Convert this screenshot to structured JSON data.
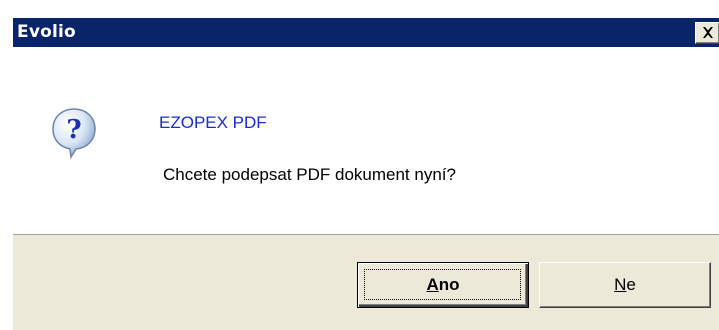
{
  "window": {
    "title": "Evolio",
    "close_icon": "close-x-icon"
  },
  "message": {
    "icon": "question-icon",
    "title": "EZOPEX PDF",
    "text": "Chcete podepsat PDF dokument nyní?"
  },
  "buttons": {
    "yes": {
      "mnemonic": "A",
      "rest": "no"
    },
    "no": {
      "mnemonic": "N",
      "rest": "e"
    }
  },
  "colors": {
    "titlebar": "#0a246a",
    "dialog_face": "#ece9d8",
    "message_title": "#1c2ccc"
  }
}
